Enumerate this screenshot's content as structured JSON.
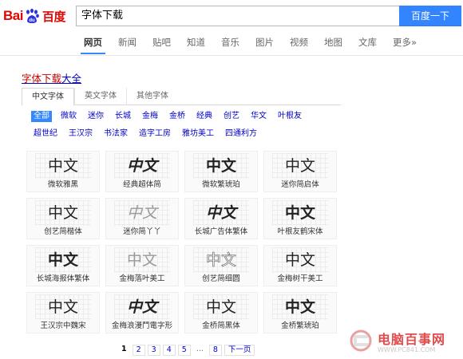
{
  "logo": {
    "part1": "Bai",
    "part2": "du",
    "cn": "百度"
  },
  "search": {
    "query": "字体下载",
    "button": "百度一下"
  },
  "nav": [
    "网页",
    "新闻",
    "贴吧",
    "知道",
    "音乐",
    "图片",
    "视频",
    "地图",
    "文库",
    "更多»"
  ],
  "result": {
    "title_hl": "字体下载",
    "title_rest": "大全"
  },
  "tabs": [
    "中文字体",
    "英文字体",
    "其他字体"
  ],
  "filters": [
    "全部",
    "微软",
    "迷你",
    "长城",
    "金梅",
    "金桥",
    "经典",
    "创艺",
    "华文",
    "叶根友",
    "超世纪",
    "王汉宗",
    "书法家",
    "造字工房",
    "雅坊美工",
    "四通利方"
  ],
  "fonts": [
    {
      "sample": "中文",
      "name": "微软雅黑"
    },
    {
      "sample": "中文",
      "name": "经典超体简"
    },
    {
      "sample": "中文",
      "name": "微软繁琥珀"
    },
    {
      "sample": "中文",
      "name": "迷你简启体"
    },
    {
      "sample": "中文",
      "name": "创艺简楷体"
    },
    {
      "sample": "中文",
      "name": "迷你简丫丫"
    },
    {
      "sample": "中文",
      "name": "长城广告体繁体"
    },
    {
      "sample": "中文",
      "name": "叶根友鹤宋体"
    },
    {
      "sample": "中文",
      "name": "长城海报体繁体"
    },
    {
      "sample": "中文",
      "name": "金梅落叶美工"
    },
    {
      "sample": "中文",
      "name": "创艺简细圆"
    },
    {
      "sample": "中文",
      "name": "金梅树干美工"
    },
    {
      "sample": "中文",
      "name": "王汉宗中魏宋"
    },
    {
      "sample": "中文",
      "name": "金梅浪漫鬥電字形"
    },
    {
      "sample": "中文",
      "name": "金桥简黑体"
    },
    {
      "sample": "中文",
      "name": "金桥繁琥珀"
    }
  ],
  "pager": {
    "pages": [
      "1",
      "2",
      "3",
      "4",
      "5",
      "...",
      "8"
    ],
    "next": "下一页"
  },
  "watermark": {
    "text": "电脑百事网",
    "url": "WWW.PC841.COM"
  }
}
